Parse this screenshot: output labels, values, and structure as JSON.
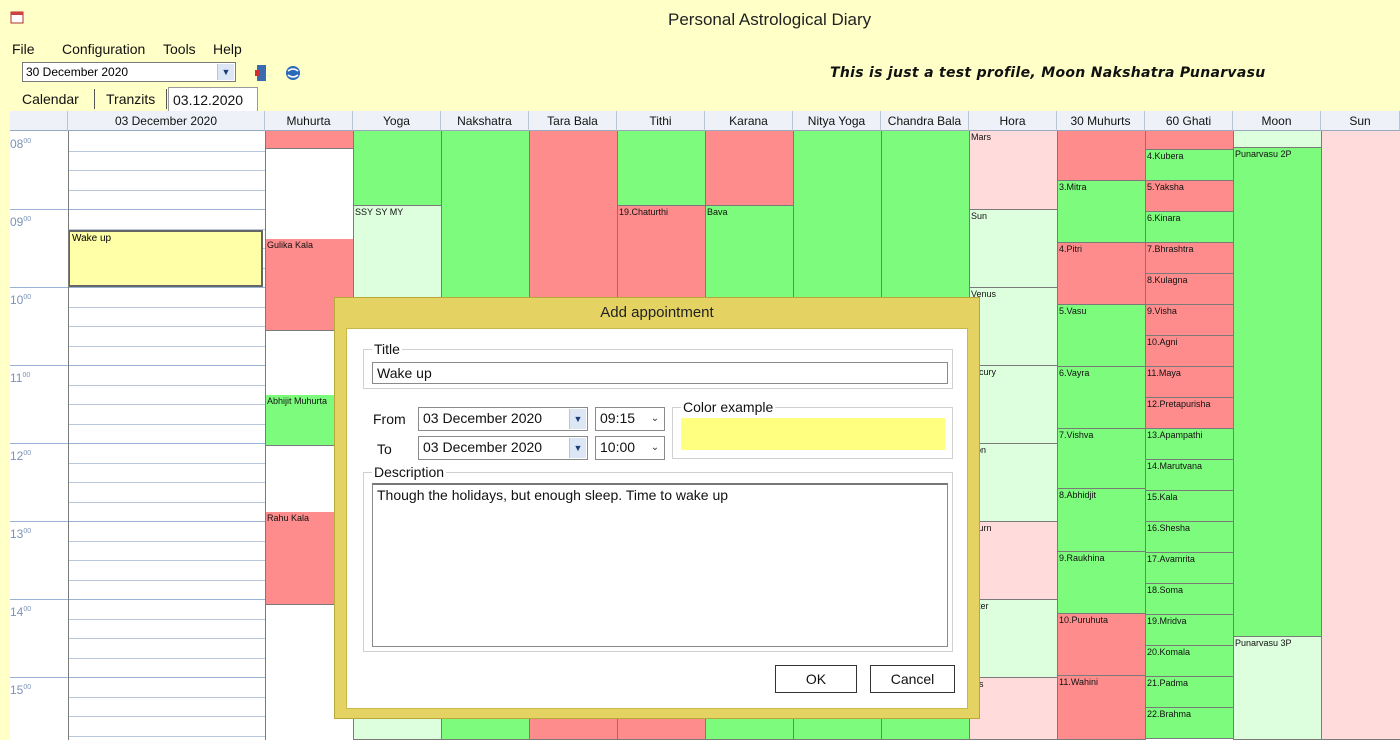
{
  "window": {
    "title": "Personal Astrological Diary"
  },
  "menu": [
    "File",
    "Configuration",
    "Tools",
    "Help"
  ],
  "toolbar": {
    "date_value": "30 December 2020",
    "profile_text": "This is just a test profile, Moon Nakshatra Punarvasu"
  },
  "tabs": [
    "Calendar",
    "Tranzits",
    "03.12.2020"
  ],
  "grid": {
    "columns": [
      "03 December 2020",
      "Muhurta",
      "Yoga",
      "Nakshatra",
      "Tara Bala",
      "Tithi",
      "Karana",
      "Nitya Yoga",
      "Chandra Bala",
      "Hora",
      "30 Muhurts",
      "60 Ghati",
      "Moon",
      "Sun"
    ],
    "hours": [
      "08",
      "09",
      "10",
      "11",
      "12",
      "13",
      "14",
      "15"
    ],
    "hour_suffix": "00",
    "appointment": "Wake up",
    "muhurta": [
      "Gulika Kala",
      "Abhijit Muhurta",
      "Rahu Kala"
    ],
    "yoga": "SSY SY MY",
    "tithi": "19.Chaturthi",
    "karana": "Bava",
    "hora": [
      "Mars",
      "Sun",
      "Venus",
      "ercury",
      "oon",
      "aturn",
      "piter",
      "ars"
    ],
    "muhurts30": [
      "3.Mitra",
      "4.Pitri",
      "5.Vasu",
      "6.Vayra",
      "7.Vishva",
      "8.Abhidjit",
      "9.Raukhina",
      "10.Puruhuta",
      "11.Wahini"
    ],
    "ghati60": [
      "4.Kubera",
      "5.Yaksha",
      "6.Kinara",
      "7.Bhrashtra",
      "8.Kulagna",
      "9.Visha",
      "10.Agni",
      "11.Maya",
      "12.Pretapurisha",
      "13.Apampathi",
      "14.Marutvana",
      "15.Kala",
      "16.Shesha",
      "17.Avamrita",
      "18.Soma",
      "19.Mridva",
      "20.Komala",
      "21.Padma",
      "22.Brahma"
    ],
    "moon": [
      "Punarvasu 2P",
      "Punarvasu 3P"
    ]
  },
  "dialog": {
    "title": "Add appointment",
    "title_label": "Title",
    "title_value": "Wake up",
    "from_label": "From",
    "to_label": "To",
    "from_date": "03 December 2020",
    "from_time": "09:15",
    "to_date": "03 December 2020",
    "to_time": "10:00",
    "color_label": "Color example",
    "color_value": "#ffff80",
    "description_label": "Description",
    "description_value": "Though the holidays, but enough sleep. Time to wake up",
    "ok_label": "OK",
    "cancel_label": "Cancel"
  },
  "colors": {
    "good": "#7cfb7c",
    "bad": "#ff8c8c",
    "light_good": "#ddffdd",
    "light_bad": "#ffdbdb",
    "appointment": "#ffffa8",
    "chrome": "#ffffc8"
  }
}
